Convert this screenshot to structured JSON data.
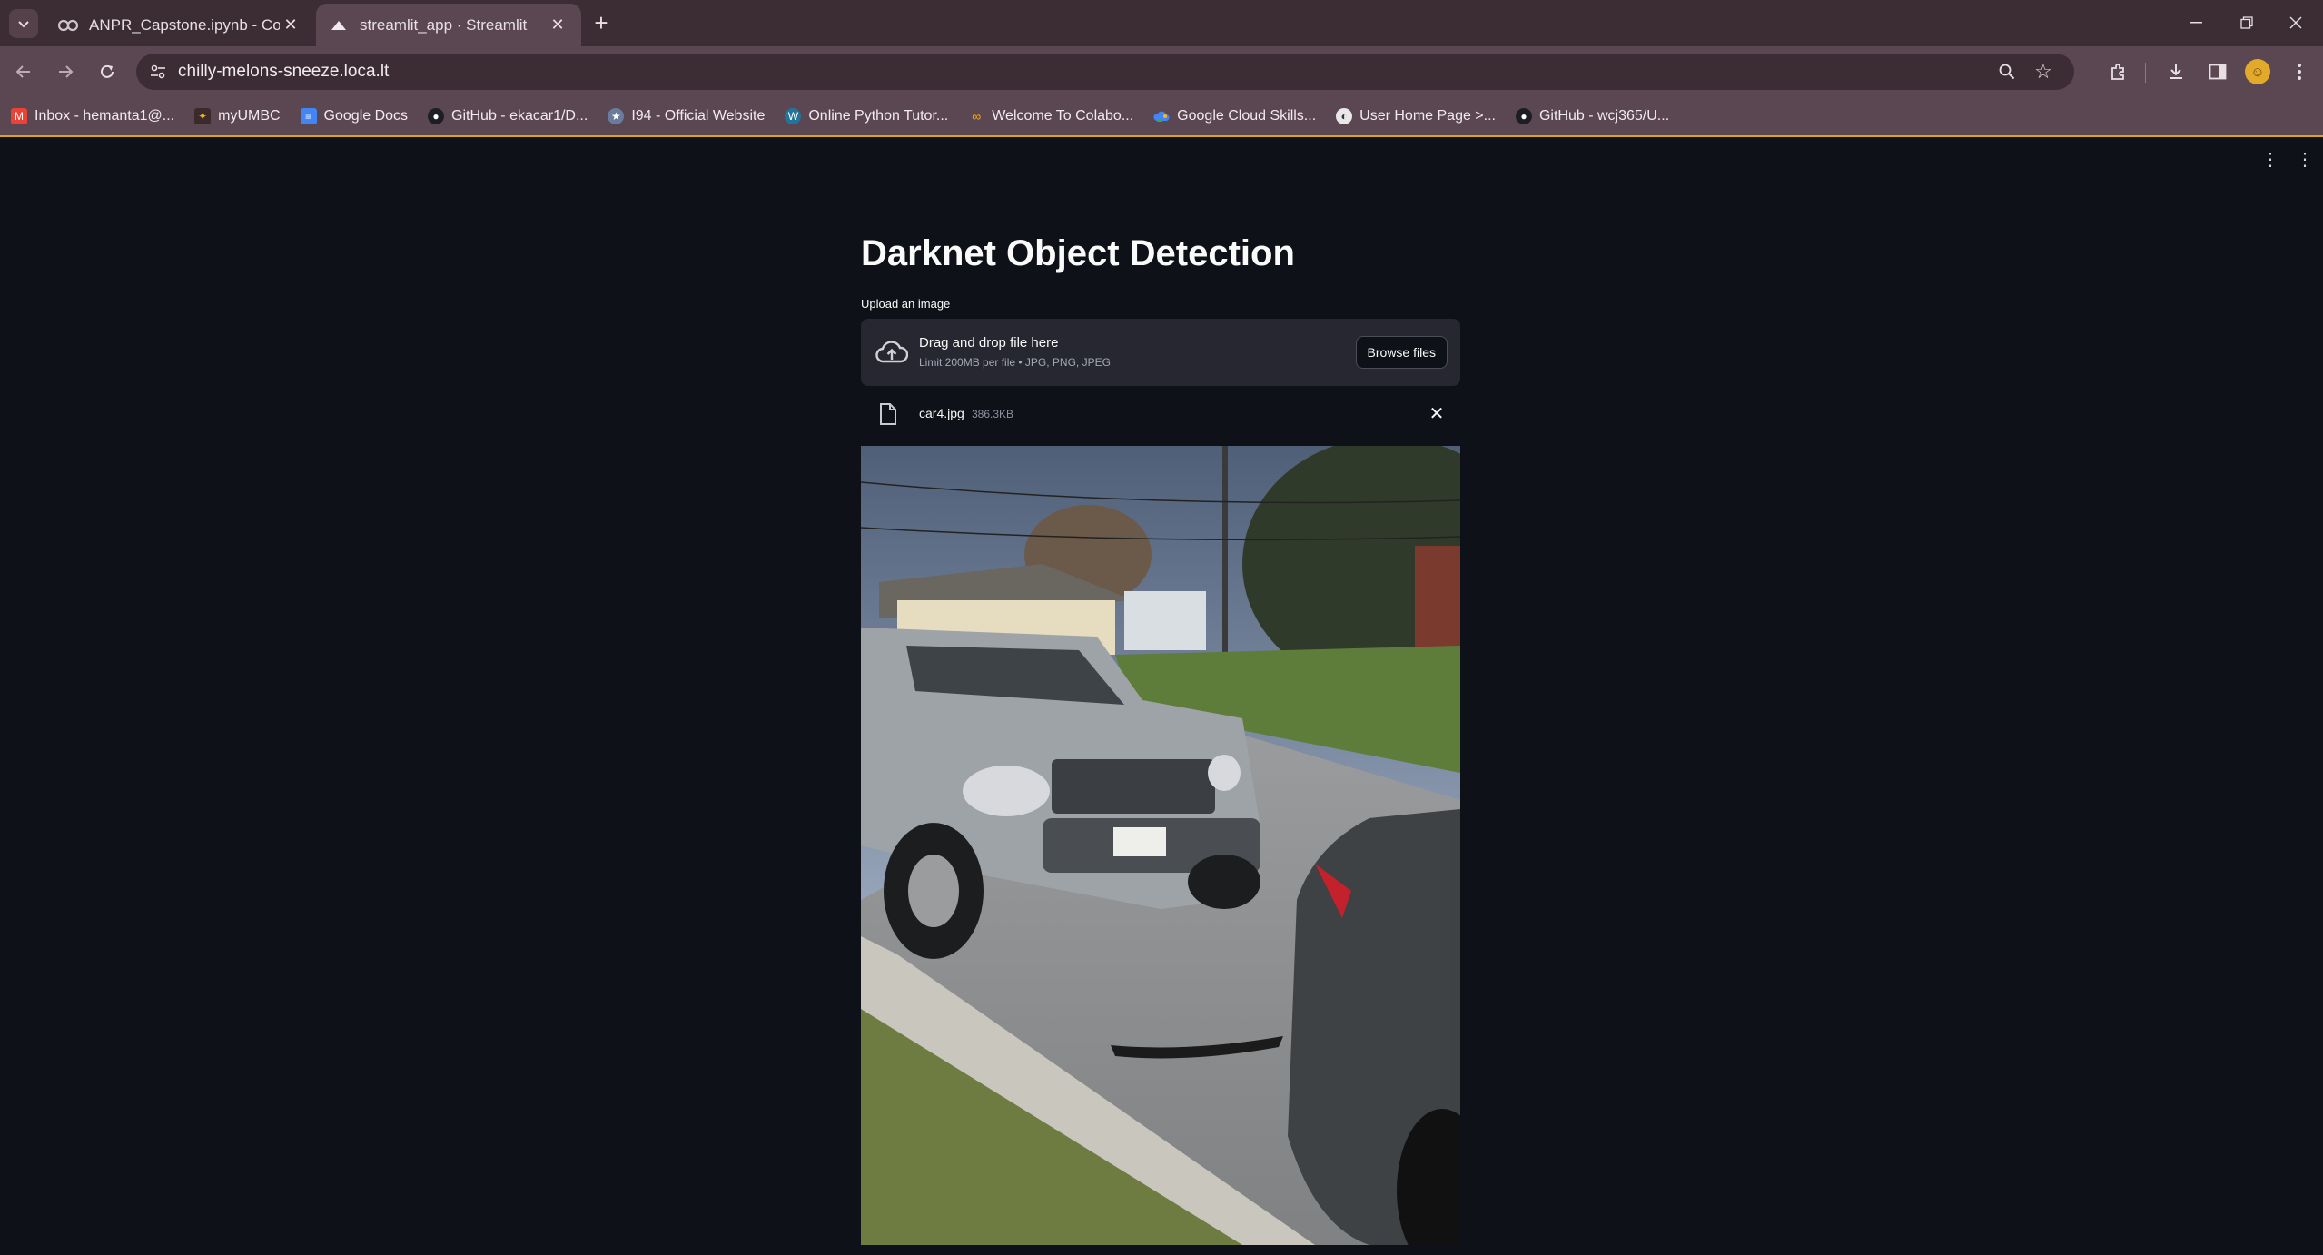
{
  "browser": {
    "tabs": [
      {
        "title": "ANPR_Capstone.ipynb - Colab",
        "active": false,
        "icon": "colab-icon"
      },
      {
        "title": "streamlit_app · Streamlit",
        "active": true,
        "icon": "streamlit-icon"
      }
    ],
    "url": "chilly-melons-sneeze.loca.lt",
    "bookmarks": [
      {
        "label": "Inbox - hemanta1@...",
        "icon": "gmail-icon",
        "color": "#ea4335"
      },
      {
        "label": "myUMBC",
        "icon": "umbc-icon",
        "color": "#f0b323"
      },
      {
        "label": "Google Docs",
        "icon": "docs-icon",
        "color": "#4285f4"
      },
      {
        "label": "GitHub - ekacar1/D...",
        "icon": "github-icon",
        "color": "#24292e"
      },
      {
        "label": "I94 - Official Website",
        "icon": "seal-icon",
        "color": "#6b7b9b"
      },
      {
        "label": "Online Python Tutor...",
        "icon": "wordpress-icon",
        "color": "#21759b"
      },
      {
        "label": "Welcome To Colabo...",
        "icon": "colab-icon",
        "color": "#f9ab00"
      },
      {
        "label": "Google Cloud Skills...",
        "icon": "cloud-icon",
        "color": "#34a853"
      },
      {
        "label": "User Home Page >...",
        "icon": "globe-icon",
        "color": "#9aa0a6"
      },
      {
        "label": "GitHub - wcj365/U...",
        "icon": "github-icon",
        "color": "#24292e"
      }
    ]
  },
  "app": {
    "title": "Darknet Object Detection",
    "uploader": {
      "label": "Upload an image",
      "drop_text": "Drag and drop file here",
      "limit_text": "Limit 200MB per file • JPG, PNG, JPEG",
      "browse_label": "Browse files"
    },
    "file": {
      "name": "car4.jpg",
      "size": "386.3KB"
    }
  },
  "colors": {
    "app_bg": "#0e1117",
    "dropzone_bg": "#262730",
    "chrome": "#5b4751",
    "tabbar": "#3c2d35"
  }
}
